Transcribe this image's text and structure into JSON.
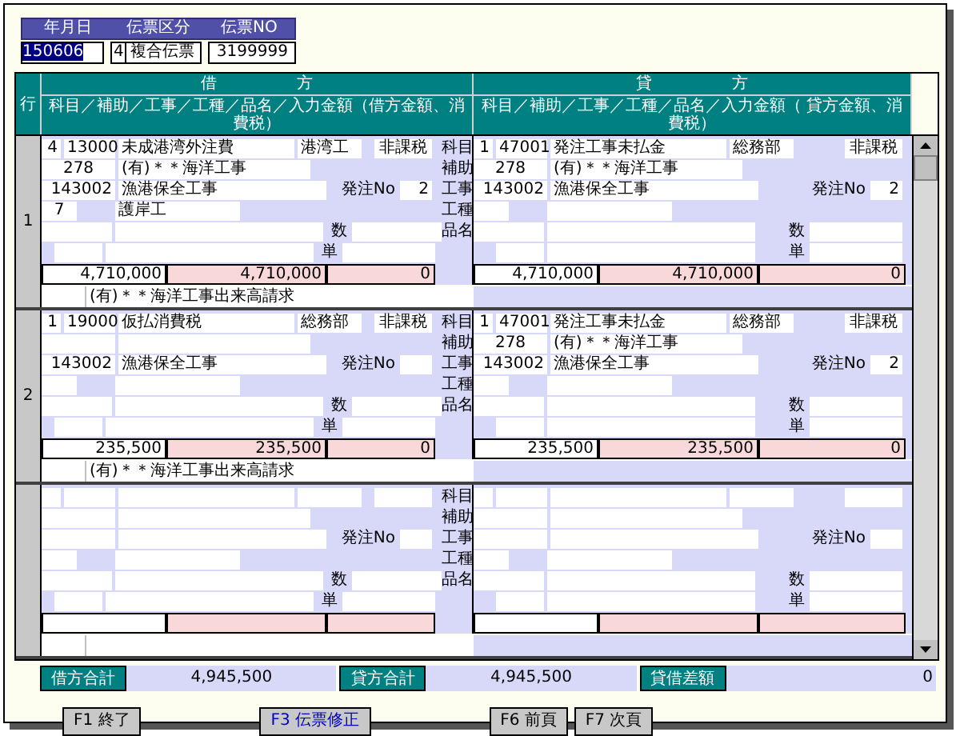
{
  "header": {
    "labels": [
      "年月日",
      "伝票区分",
      "伝票NO"
    ],
    "date": {
      "value": "150606",
      "selected": true
    },
    "slip_type_code": "4",
    "slip_type": "複合伝票",
    "slip_no": "3199999"
  },
  "grid": {
    "row_header": "行",
    "debit_title": "借　　　　　方",
    "credit_title": "貸　　　　　方",
    "debit_subtitle": "科目／補助／工事／工種／品名／入力金額（借方金額、消費税）",
    "credit_subtitle": "科目／補助／工事／工種／品名／入力金額（ 貸方金額、消費税）"
  },
  "rows": [
    {
      "number": "1",
      "labels": [
        "科目",
        "補助",
        "工事",
        "工種",
        "品名"
      ],
      "memo": "(有)＊＊海洋工事出来高請求",
      "debit": {
        "seq": "4",
        "account_code": "13000",
        "account": "未成港湾外注費",
        "dept": "港湾工",
        "tax": "非課税",
        "sub_code": "278",
        "sub_name": "(有)＊＊海洋工事",
        "project_code": "143002",
        "project": "漁港保全工事",
        "order_no_label": "発注No",
        "order_no": "2",
        "work_code": "7",
        "work": "護岸工",
        "qty_label": "数",
        "price_label": "単",
        "amount": "4,710,000",
        "input_amount": "4,710,000",
        "tax_amount": "0"
      },
      "credit": {
        "seq": "1",
        "account_code": "47001",
        "account": "発注工事未払金",
        "dept": "総務部",
        "tax": "非課税",
        "sub_code": "278",
        "sub_name": "(有)＊＊海洋工事",
        "project_code": "143002",
        "project": "漁港保全工事",
        "order_no_label": "発注No",
        "order_no": "2",
        "qty_label": "数",
        "price_label": "単",
        "amount": "4,710,000",
        "input_amount": "4,710,000",
        "tax_amount": "0"
      }
    },
    {
      "number": "2",
      "labels": [
        "科目",
        "補助",
        "工事",
        "工種",
        "品名"
      ],
      "memo": "(有)＊＊海洋工事出来高請求",
      "debit": {
        "seq": "1",
        "account_code": "19000",
        "account": "仮払消費税",
        "dept": "総務部",
        "tax": "非課税",
        "project_code": "143002",
        "project": "漁港保全工事",
        "order_no_label": "発注No",
        "qty_label": "数",
        "price_label": "単",
        "amount": "235,500",
        "input_amount": "235,500",
        "tax_amount": "0"
      },
      "credit": {
        "seq": "1",
        "account_code": "47001",
        "account": "発注工事未払金",
        "dept": "総務部",
        "tax": "非課税",
        "sub_code": "278",
        "sub_name": "(有)＊＊海洋工事",
        "project_code": "143002",
        "project": "漁港保全工事",
        "order_no_label": "発注No",
        "order_no": "2",
        "qty_label": "数",
        "price_label": "単",
        "amount": "235,500",
        "input_amount": "235,500",
        "tax_amount": "0"
      }
    },
    {
      "labels": [
        "科目",
        "補助",
        "工事",
        "工種",
        "品名"
      ],
      "debit": {
        "order_no_label": "発注No",
        "qty_label": "数",
        "price_label": "単"
      },
      "credit": {
        "order_no_label": "発注No",
        "qty_label": "数",
        "price_label": "単"
      }
    }
  ],
  "totals": [
    {
      "label": "借方合計",
      "value": "4,945,500"
    },
    {
      "label": "貸方合計",
      "value": "4,945,500"
    },
    {
      "label": "貸借差額",
      "value": "0"
    }
  ],
  "buttons": [
    {
      "label": "F1 終了",
      "highlighted": false
    },
    {
      "label": "F3 伝票修正",
      "highlighted": true
    },
    {
      "label": "F6 前頁",
      "highlighted": false
    },
    {
      "label": "F7 次頁",
      "highlighted": false
    }
  ]
}
